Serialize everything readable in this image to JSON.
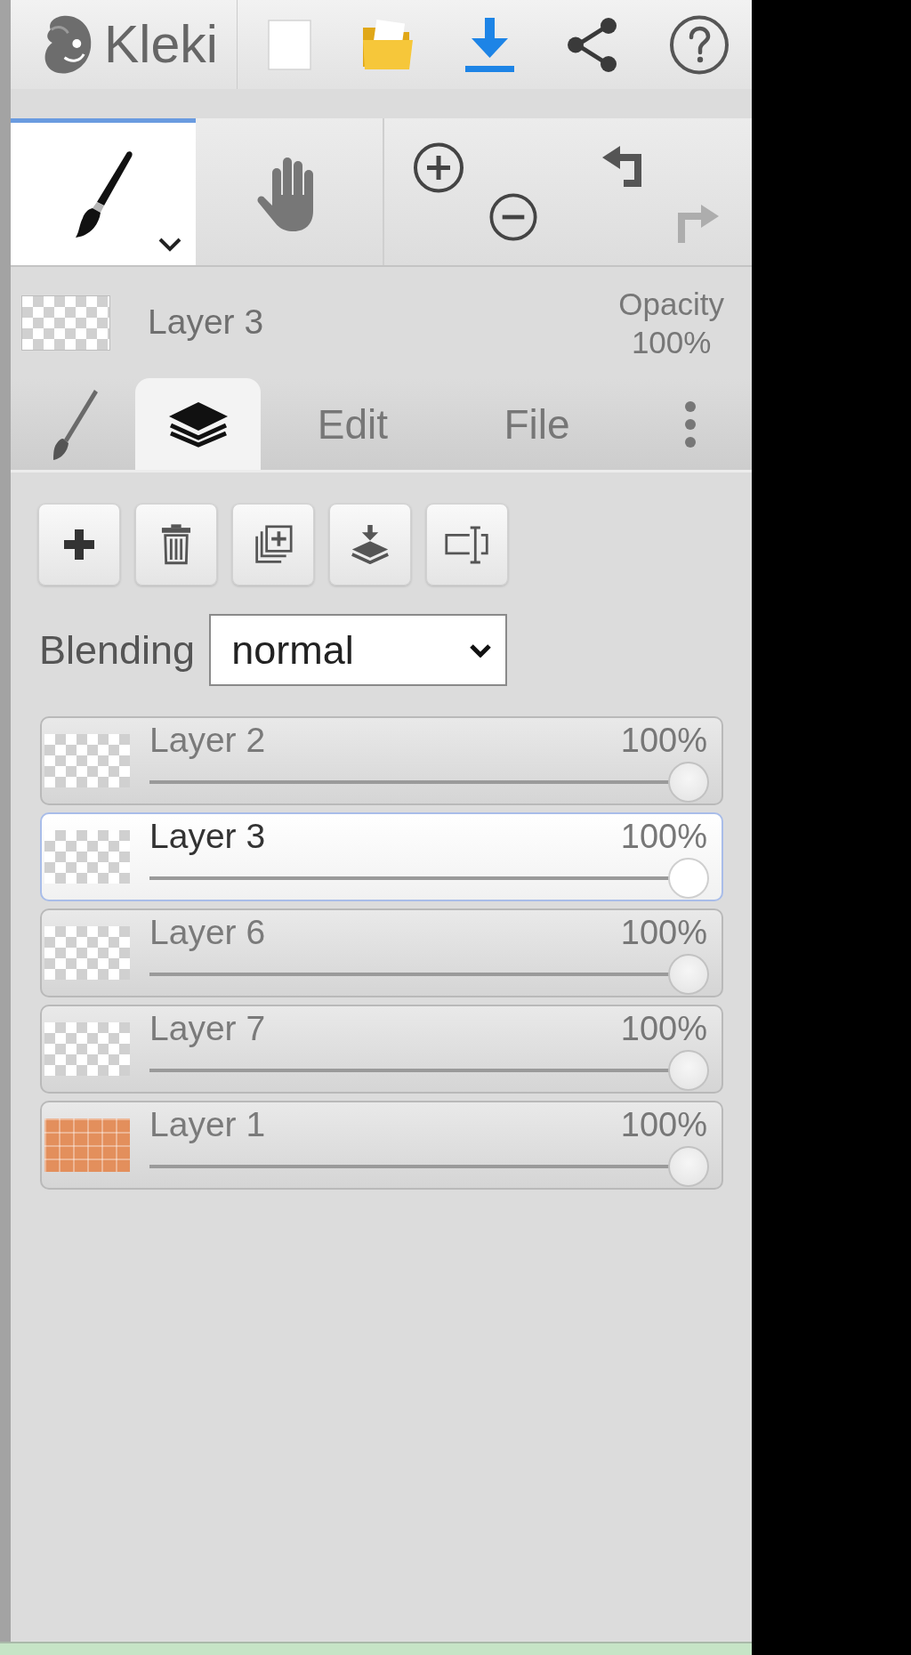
{
  "header": {
    "app_name": "Kleki"
  },
  "tools": [
    {
      "kind": "brush",
      "selected": true
    },
    {
      "kind": "hand",
      "selected": false
    }
  ],
  "history": [
    {
      "kind": "undo",
      "disabled": false
    },
    {
      "kind": "redo",
      "disabled": true
    }
  ],
  "current_layer": {
    "name": "Layer 3",
    "opacity_label": "Opacity",
    "opacity": "100%"
  },
  "tabs": [
    {
      "kind": "brush",
      "selected": false
    },
    {
      "kind": "layers",
      "selected": true
    },
    {
      "kind": "text",
      "label": "Edit",
      "selected": false
    },
    {
      "kind": "text",
      "label": "File",
      "selected": false
    },
    {
      "kind": "more",
      "selected": false
    }
  ],
  "layers_panel": {
    "blending": {
      "label": "Blending",
      "value": "normal"
    },
    "layers": [
      {
        "name": "Layer 2",
        "opacity": "100%",
        "level": 1,
        "selected": false,
        "kind": "transparent"
      },
      {
        "name": "Layer 3",
        "opacity": "100%",
        "level": 1,
        "selected": true,
        "kind": "transparent"
      },
      {
        "name": "Layer 6",
        "opacity": "100%",
        "level": 1,
        "selected": false,
        "kind": "transparent"
      },
      {
        "name": "Layer 7",
        "opacity": "100%",
        "level": 1,
        "selected": false,
        "kind": "transparent"
      },
      {
        "name": "Layer 1",
        "opacity": "100%",
        "level": 1,
        "selected": false,
        "kind": "filled"
      }
    ]
  }
}
